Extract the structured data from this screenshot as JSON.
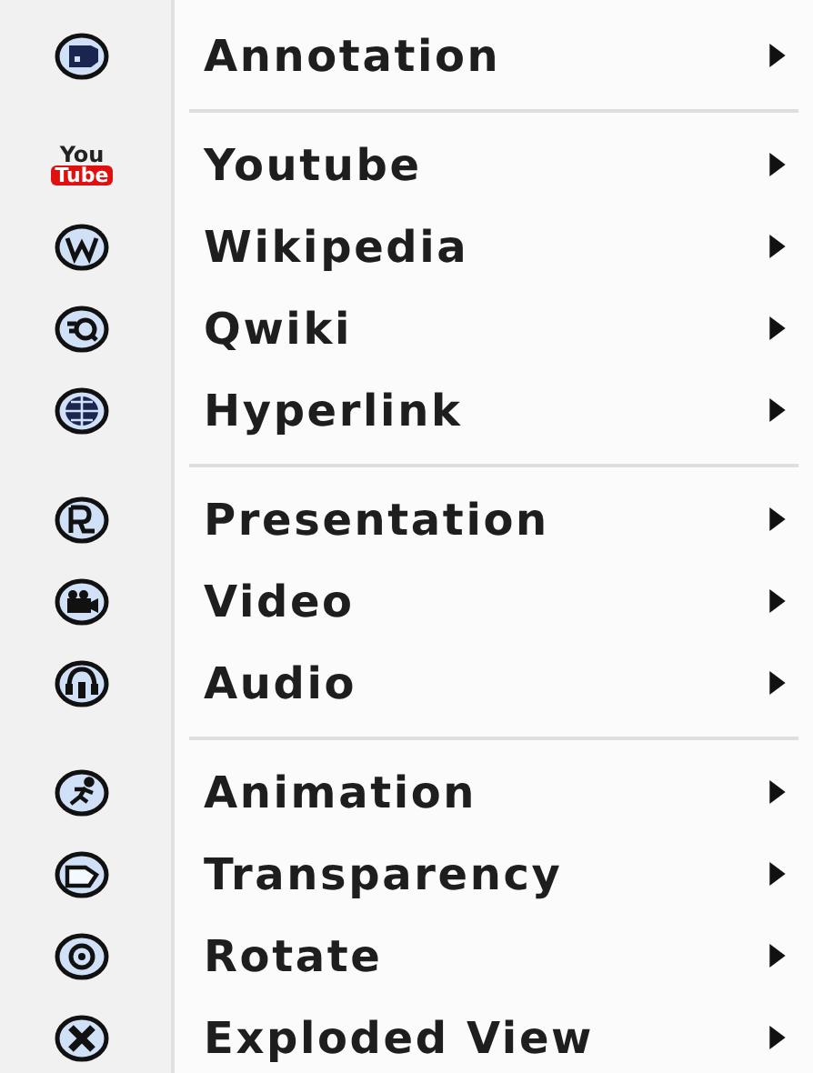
{
  "menu": {
    "groups": [
      {
        "items": [
          {
            "label": "Annotation"
          }
        ]
      },
      {
        "items": [
          {
            "label": "Youtube",
            "logo": [
              "You",
              "Tube"
            ]
          },
          {
            "label": "Wikipedia"
          },
          {
            "label": "Qwiki"
          },
          {
            "label": "Hyperlink"
          }
        ]
      },
      {
        "items": [
          {
            "label": "Presentation"
          },
          {
            "label": "Video"
          },
          {
            "label": "Audio"
          }
        ]
      },
      {
        "items": [
          {
            "label": "Animation"
          },
          {
            "label": "Transparency"
          },
          {
            "label": "Rotate"
          },
          {
            "label": "Exploded View"
          }
        ]
      }
    ]
  }
}
